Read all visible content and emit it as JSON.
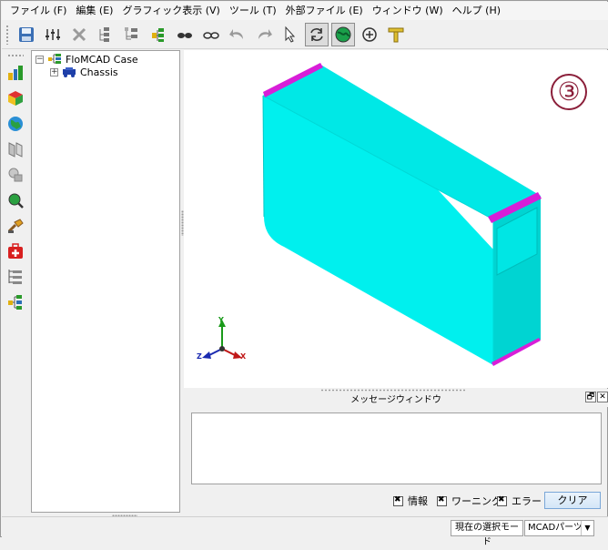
{
  "menu": {
    "items": [
      {
        "label": "ファイル (F)"
      },
      {
        "label": "編集 (E)"
      },
      {
        "label": "グラフィック表示 (V)"
      },
      {
        "label": "ツール (T)"
      },
      {
        "label": "外部ファイル (E)"
      },
      {
        "label": "ウィンドウ (W)"
      },
      {
        "label": "ヘルプ (H)"
      }
    ]
  },
  "tree": {
    "root": {
      "label": "FloMCAD Case",
      "expander": "−"
    },
    "child": {
      "label": "Chassis",
      "expander": "+"
    }
  },
  "viewport": {
    "badge": "③",
    "axes": {
      "y": "Y",
      "x": "X",
      "z": "Z"
    },
    "model_colors": {
      "body": "#00f0ee",
      "edge": "#d81ed8"
    }
  },
  "message": {
    "title": "メッセージウィンドウ",
    "restore_glyph": "🗗",
    "close_glyph": "✕",
    "filters": [
      {
        "label": "情報",
        "checked": true
      },
      {
        "label": "ワーニング",
        "checked": true
      },
      {
        "label": "エラー",
        "checked": true
      }
    ],
    "clear_label": "クリア"
  },
  "status": {
    "mode_label": "現在の選択モード",
    "mode_value": "MCADパーツ",
    "dropdown_glyph": "▼"
  }
}
